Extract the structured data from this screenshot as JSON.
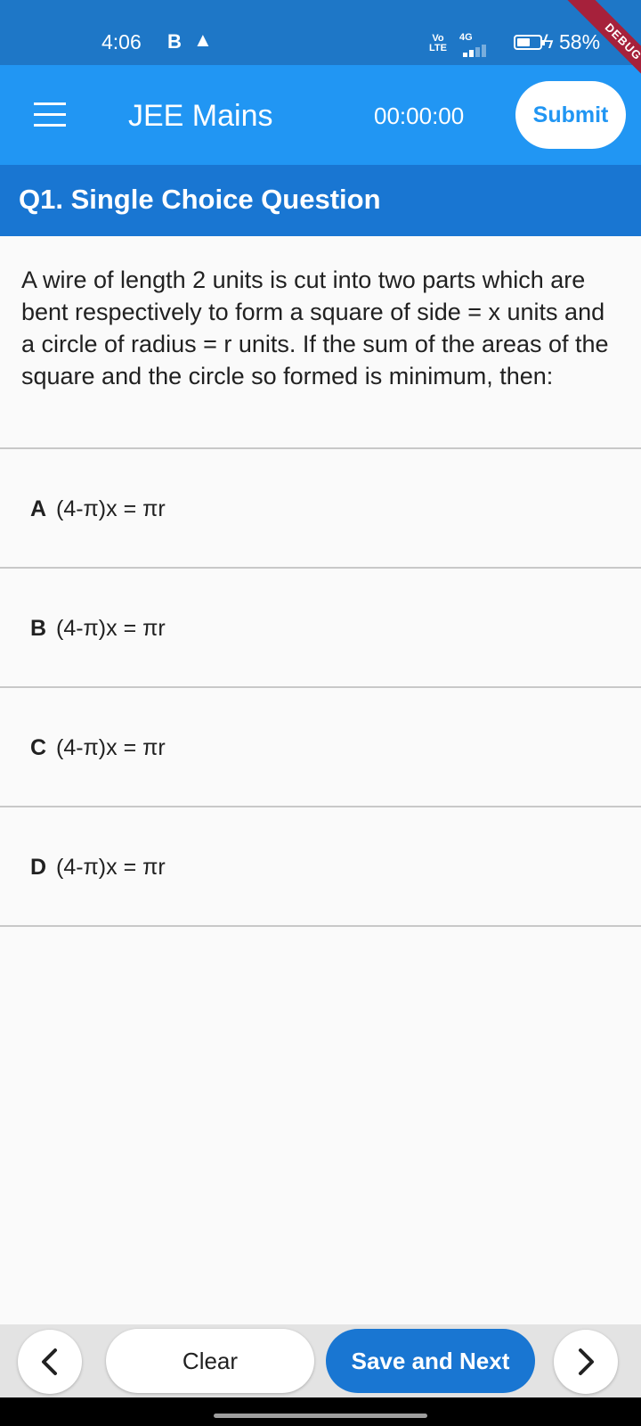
{
  "status_bar": {
    "time": "4:06",
    "notif_b": "B",
    "notif_warning": "▲",
    "volte": "Vo\nLTE",
    "network": "4G",
    "battery_percent": "58%",
    "battery_level": 0.58,
    "charging_icon": "bolt-icon"
  },
  "debug_banner": "DEBUG",
  "app_bar": {
    "menu_icon": "hamburger-menu-icon",
    "title": "JEE Mains",
    "timer": "00:00:00",
    "submit_label": "Submit"
  },
  "question": {
    "header": "Q1. Single Choice Question",
    "text": "A wire of length 2 units is cut into two parts which are bent respectively to form a square of side = x units and a circle of radius = r units. If the sum of the areas of the square and the circle so formed is minimum, then:"
  },
  "options": [
    {
      "letter": "A",
      "text": "(4-π)x = πr"
    },
    {
      "letter": "B",
      "text": "(4-π)x = πr"
    },
    {
      "letter": "C",
      "text": "(4-π)x = πr"
    },
    {
      "letter": "D",
      "text": "(4-π)x = πr"
    }
  ],
  "bottom_bar": {
    "prev_icon": "chevron-left-icon",
    "clear_label": "Clear",
    "save_label": "Save and Next",
    "next_icon": "chevron-right-icon"
  },
  "colors": {
    "status_bar": "#1e77c7",
    "app_bar": "#2196f3",
    "question_header": "#1976d2",
    "save_button": "#1976d2",
    "debug_banner": "#a6213b"
  }
}
